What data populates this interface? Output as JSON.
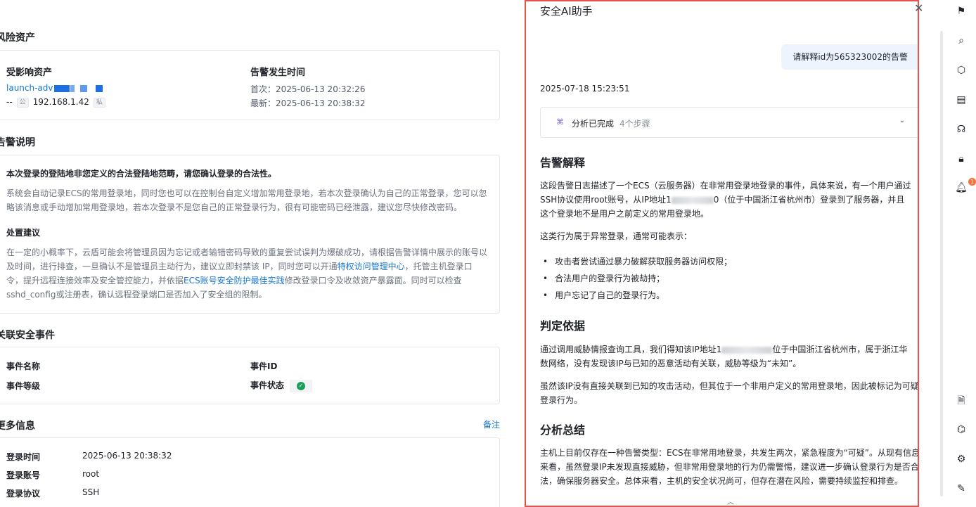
{
  "left": {
    "risk_assets_title": "风险资产",
    "affected_asset_label": "受影响资产",
    "asset_name": "launch-adv",
    "asset_prefix": "--",
    "tag_public": "公",
    "ip": "192.168.1.42",
    "tag_private": "私",
    "alert_time_label": "告警发生时间",
    "first_time": "首次：2025-06-13 20:32:26",
    "latest_time": "最新：2025-06-13 20:38:32",
    "alert_desc_title": "告警说明",
    "desc_strong": "本次登录的登陆地非您定义的合法登陆地范畴，请您确认登录的合法性。",
    "desc_line1": "系统会自动记录ECS的常用登录地，同时您也可以在控制台自定义增加常用登录地，若本次登录确认为自己的正常登录，您可以忽",
    "desc_line2": "略该消息或手动增加常用登录地，若本次登录不是您自己的正常登录行为，很有可能密码已经泄露，建议您尽快修改密码。",
    "advice_title": "处置建议",
    "advice_line1": "在一定的小概率下，云盾可能会将管理员因为忘记或者输错密码导致的重复尝试误判为爆破成功，请根据告警详情中展示的账号以",
    "advice_line2": "及时间，进行排查，一旦确认不是管理员主动行为，建议立即封禁该 IP，同时您可以开通",
    "advice_link1": "特权访问管理中心",
    "advice_line2b": "，托管主机登录口",
    "advice_line3a": "令，提升远程连接效率及安全管控能力，并依据",
    "advice_link2": "ECS账号安全防护最佳实践",
    "advice_line3b": "修改登录口令及收敛资产暴露面。同时可以检查",
    "advice_line4": "sshd_config或注册表，确认远程登录端口是否加入了安全组的限制。",
    "related_title": "关联安全事件",
    "event_name_label": "事件名称",
    "event_id_label": "事件ID",
    "event_level_label": "事件等级",
    "event_status_label": "事件状态",
    "more_info_title": "更多信息",
    "remark_link": "备注",
    "login_time_label": "登录时间",
    "login_time_value": "2025-06-13 20:38:32",
    "login_account_label": "登录账号",
    "login_account_value": "root",
    "login_protocol_label": "登录协议",
    "login_protocol_value": "SSH"
  },
  "ai": {
    "title": "安全AI助手",
    "user_query": "请解释id为565323002的告警",
    "timestamp": "2025-07-18 15:23:51",
    "steps_status": "分析已完成",
    "steps_count": "4个步骤",
    "h_explain": "告警解释",
    "p1_a": "这段告警日志描述了一个ECS（云服务器）在非常用登录地登录的事件，具体来说，有一个用户通过",
    "p1_b1": "SSH协议使用root账号，从IP地址1",
    "p1_b2": "0（位于中国浙江省杭州市）登录到了服务器，并且",
    "p1_c": "这个登录地不是用户之前定义的常用登录地。",
    "p2": "这类行为属于异常登录，通常可能表示：",
    "li1": "攻击者尝试通过暴力破解获取服务器访问权限；",
    "li2": "合法用户的登录行为被劫持；",
    "li3": "用户忘记了自己的登录行为。",
    "h_basis": "判定依据",
    "p3_a1": "通过调用威胁情报查询工具，我们得知该IP地址1",
    "p3_a2": "位于中国浙江省杭州市，属于浙江华",
    "p3_b": "数网络，没有发现该IP与已知的恶意活动有关联，威胁等级为“未知”。",
    "p4_a": "虽然该IP没有直接关联到已知的攻击活动，但其位于一个非用户定义的常用登录地，因此被标记为可疑",
    "p4_b": "登录行为。",
    "h_summary": "分析总结",
    "p5_a": "主机上目前仅存在一种告警类型：ECS在非常用地登录，共发生两次，紧急程度为“可疑”。从现有信息",
    "p5_b": "来看，虽然登录IP未发现直接威胁，但非常用登录地的行为仍需警惕，建议进一步确认登录行为是否合",
    "p5_c": "法，确保服务器安全。总体来看，主机的安全状况尚可，但存在潜在风险，需要持续监控和排查。"
  },
  "toolbar": {
    "notification_count": "1",
    "icons": [
      "flag-icon",
      "search-icon",
      "cube-icon",
      "document-icon",
      "headset-icon",
      "lock-icon",
      "bell-icon",
      "file-icon",
      "ai-icon",
      "settings-icon",
      "edit-icon"
    ]
  },
  "colors": {
    "accent": "#1677d2",
    "highlight_border": "#e4534d",
    "bubble": "#eef4fd",
    "success": "#18a058"
  }
}
